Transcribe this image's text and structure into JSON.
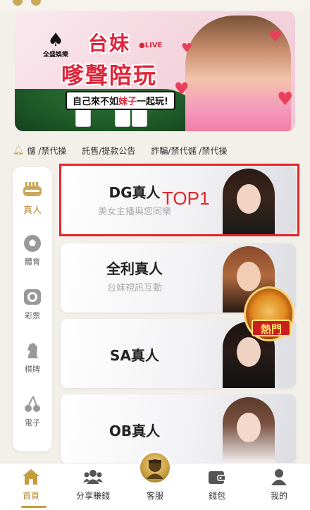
{
  "banner": {
    "logo_text": "全盛娛樂",
    "title_line1": "台妹",
    "live_tag": "●LIVE",
    "title_line2": "嗲聲陪玩",
    "slogan_prefix": "自己來不如",
    "slogan_highlight": "妹子",
    "slogan_suffix": "一起玩!"
  },
  "notice": {
    "icon": "bell-icon",
    "messages": [
      "儲 /禁代操",
      "託售/提款公告",
      "詐騙/禁代儲 /禁代操"
    ]
  },
  "sidebar": {
    "items": [
      {
        "label": "真人",
        "icon": "live-dealer-icon",
        "active": true
      },
      {
        "label": "體育",
        "icon": "soccer-ball-icon",
        "active": false
      },
      {
        "label": "彩票",
        "icon": "lottery-ball-icon",
        "active": false
      },
      {
        "label": "棋牌",
        "icon": "chess-knight-icon",
        "active": false
      },
      {
        "label": "電子",
        "icon": "cherry-icon",
        "active": false
      }
    ]
  },
  "games": [
    {
      "name": "DG真人",
      "subtitle": "美女主播與您同樂"
    },
    {
      "name": "全利真人",
      "subtitle": "台妹視訊互動"
    },
    {
      "name": "SA真人",
      "subtitle": ""
    },
    {
      "name": "OB真人",
      "subtitle": ""
    }
  ],
  "annotation": {
    "top1": "TOP1"
  },
  "hot_badge": "熱門",
  "bottom_nav": {
    "items": [
      {
        "label": "首頁",
        "icon": "home-icon",
        "active": true
      },
      {
        "label": "分享賺錢",
        "icon": "group-icon",
        "active": false
      },
      {
        "label": "客服",
        "icon": "customer-service-avatar-icon",
        "active": false
      },
      {
        "label": "錢包",
        "icon": "wallet-icon",
        "active": false
      },
      {
        "label": "我的",
        "icon": "profile-icon",
        "active": false
      }
    ]
  },
  "colors": {
    "accent_gold": "#b78a2e",
    "highlight_red": "#e5252a",
    "banner_red": "#e0243a"
  }
}
